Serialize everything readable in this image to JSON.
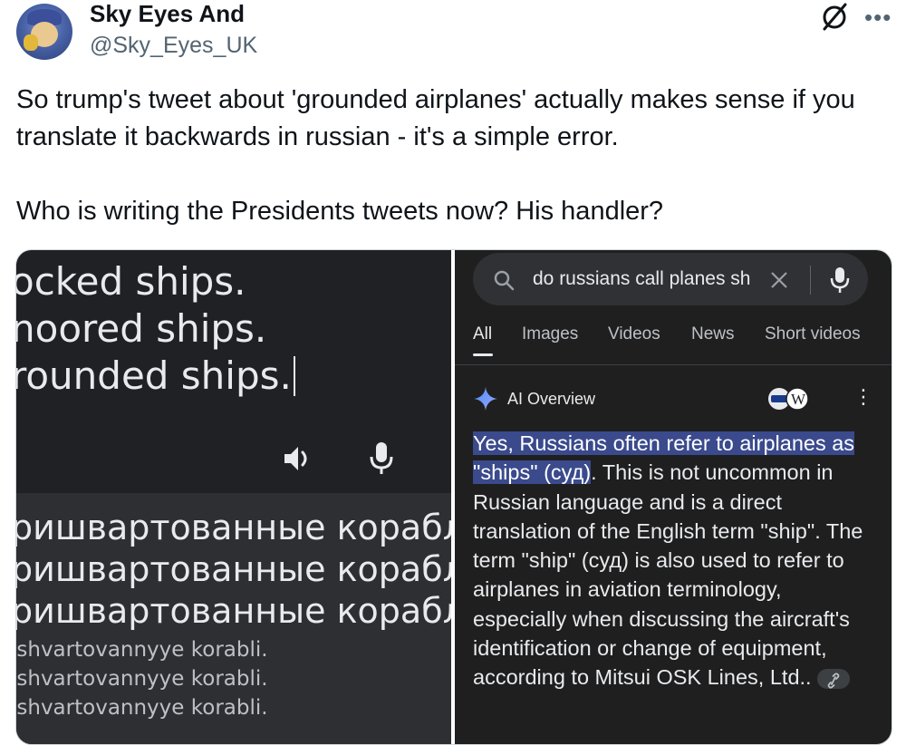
{
  "tweet": {
    "display_name": "Sky Eyes And",
    "handle": "@Sky_Eyes_UK",
    "text_line1": "So trump's tweet about 'grounded airplanes' actually makes sense if you translate it backwards in russian - it's a simple error.",
    "text_line2": "Who is writing the Presidents tweets now? His handler?",
    "icons": {
      "grok": "slashed-circle-icon",
      "more": "more-dots-icon"
    }
  },
  "translate": {
    "source_lines": [
      "ocked ships.",
      "noored ships.",
      "rounded ships."
    ],
    "translation_lines": [
      "ришвартованные корабли.",
      "ришвартованные корабли.",
      "ришвартованные корабли."
    ],
    "romanization_lines": [
      "ishvartovannyye korabli.",
      "ishvartovannyye korabli.",
      "ishvartovannyye korabli."
    ]
  },
  "search": {
    "query": "do russians call planes sh",
    "tabs": [
      "All",
      "Images",
      "Videos",
      "News",
      "Short videos"
    ],
    "active_tab": "All"
  },
  "ai_overview": {
    "title": "AI Overview",
    "highlight": "Yes, Russians often refer to airplanes as \"ships\" (суд)",
    "body": ". This is not uncommon in Russian language and is a direct translation of the English term \"ship\". The term \"ship\" (суд) is also used to refer to airplanes in aviation terminology, especially when discussing the aircraft's identification or change of equipment, according to Mitsui OSK Lines, Ltd.."
  },
  "colors": {
    "highlight": "#3a4a8c",
    "dark_bg": "#202124",
    "accent_blue": "#4c8bf5"
  }
}
